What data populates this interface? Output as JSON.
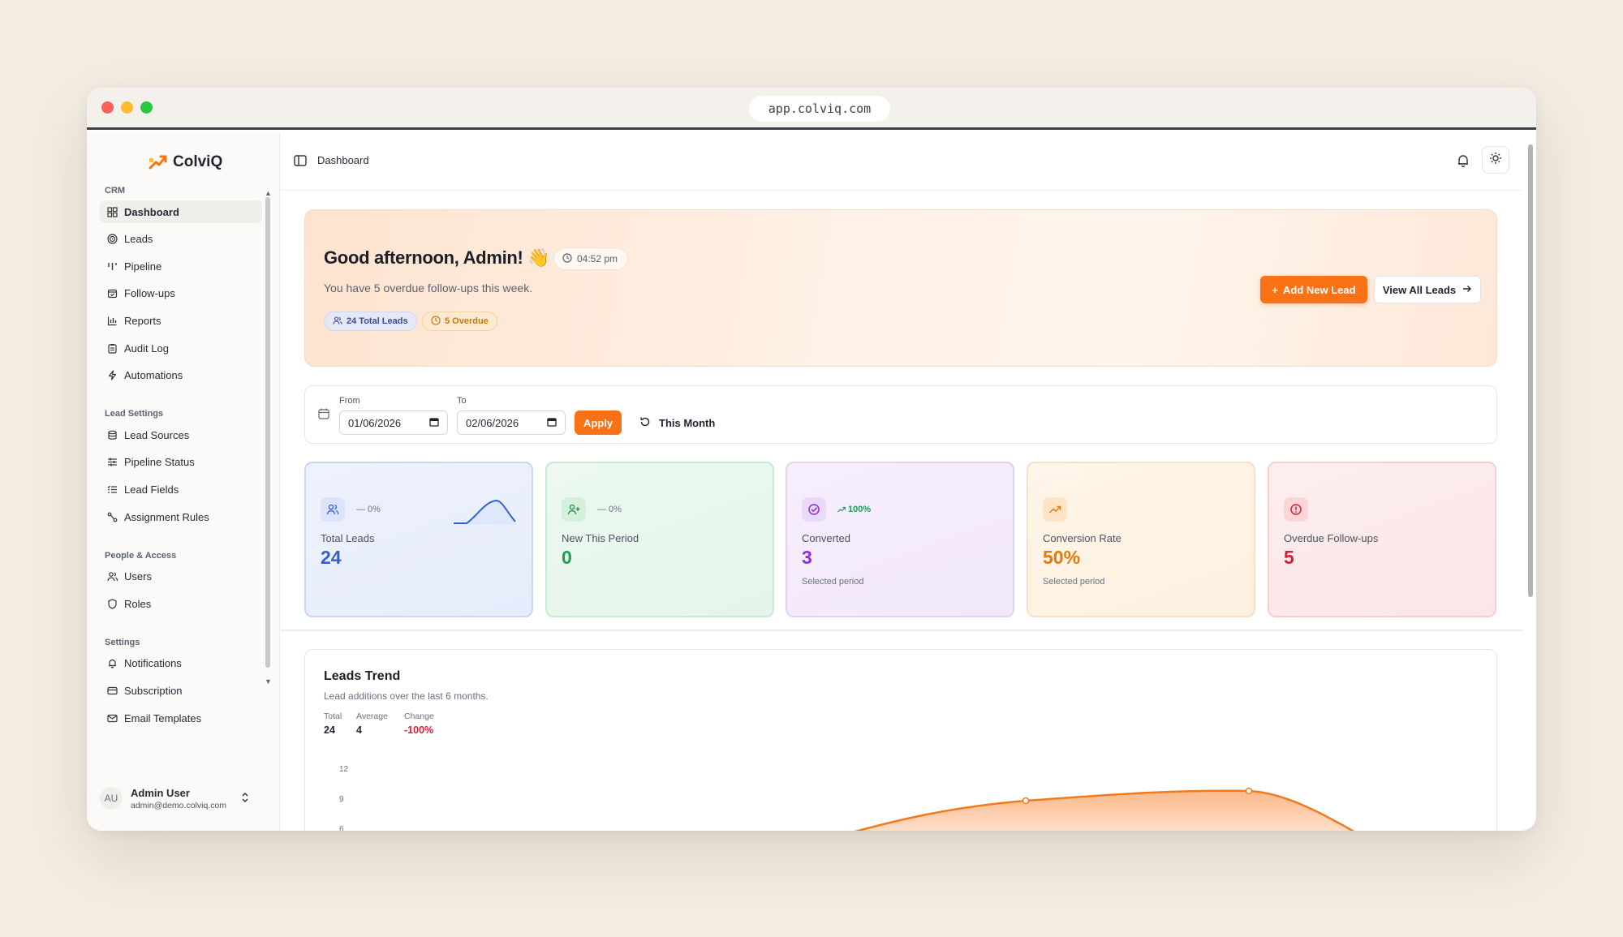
{
  "browser": {
    "url": "app.colviq.com"
  },
  "brand": {
    "name": "ColviQ",
    "accent": "#f97316"
  },
  "sidebar": {
    "sections": [
      {
        "title": "CRM",
        "items": [
          {
            "label": "Dashboard",
            "icon": "grid-icon",
            "active": true
          },
          {
            "label": "Leads",
            "icon": "target-icon"
          },
          {
            "label": "Pipeline",
            "icon": "pipeline-icon"
          },
          {
            "label": "Follow-ups",
            "icon": "calendar-check-icon"
          },
          {
            "label": "Reports",
            "icon": "bar-chart-icon"
          },
          {
            "label": "Audit Log",
            "icon": "clipboard-icon"
          },
          {
            "label": "Automations",
            "icon": "bolt-icon"
          }
        ]
      },
      {
        "title": "Lead Settings",
        "items": [
          {
            "label": "Lead Sources",
            "icon": "database-icon"
          },
          {
            "label": "Pipeline Status",
            "icon": "sliders-icon"
          },
          {
            "label": "Lead Fields",
            "icon": "list-icon"
          },
          {
            "label": "Assignment Rules",
            "icon": "route-icon"
          }
        ]
      },
      {
        "title": "People & Access",
        "items": [
          {
            "label": "Users",
            "icon": "users-icon"
          },
          {
            "label": "Roles",
            "icon": "shield-icon"
          }
        ]
      },
      {
        "title": "Settings",
        "items": [
          {
            "label": "Notifications",
            "icon": "bell-icon"
          },
          {
            "label": "Subscription",
            "icon": "card-icon"
          },
          {
            "label": "Email Templates",
            "icon": "mail-icon"
          }
        ]
      }
    ],
    "user": {
      "initials": "AU",
      "name": "Admin User",
      "email": "admin@demo.colviq.com"
    }
  },
  "topbar": {
    "breadcrumb": "Dashboard"
  },
  "hero": {
    "greeting": "Good afternoon, Admin! 👋",
    "time": "04:52 pm",
    "message": "You have 5 overdue follow-ups this week.",
    "badge_leads": "24 Total Leads",
    "badge_overdue": "5 Overdue",
    "add_button": "Add New Lead",
    "view_button": "View All Leads"
  },
  "filter": {
    "from_label": "From",
    "from_value": "01/06/2026",
    "to_label": "To",
    "to_value": "02/06/2026",
    "apply": "Apply",
    "this_month": "This Month"
  },
  "cards": {
    "total": {
      "label": "Total Leads",
      "value": "24",
      "delta": "— 0%"
    },
    "new": {
      "label": "New This Period",
      "value": "0",
      "delta": "— 0%"
    },
    "converted": {
      "label": "Converted",
      "value": "3",
      "delta": "100%",
      "sub": "Selected period"
    },
    "rate": {
      "label": "Conversion Rate",
      "value": "50%",
      "sub": "Selected period"
    },
    "overdue": {
      "label": "Overdue Follow-ups",
      "value": "5"
    }
  },
  "trend": {
    "title": "Leads Trend",
    "subtitle": "Lead additions over the last 6 months.",
    "stats": [
      {
        "label": "Total",
        "value": "24"
      },
      {
        "label": "Average",
        "value": "4"
      },
      {
        "label": "Change",
        "value": "-100%"
      }
    ],
    "yticks": [
      "12",
      "9",
      "6"
    ]
  },
  "chart_data": {
    "type": "area",
    "title": "Leads Trend",
    "y_ticks": [
      12,
      9,
      6
    ],
    "visible_points": [
      9,
      10
    ],
    "color": "#f97316"
  }
}
